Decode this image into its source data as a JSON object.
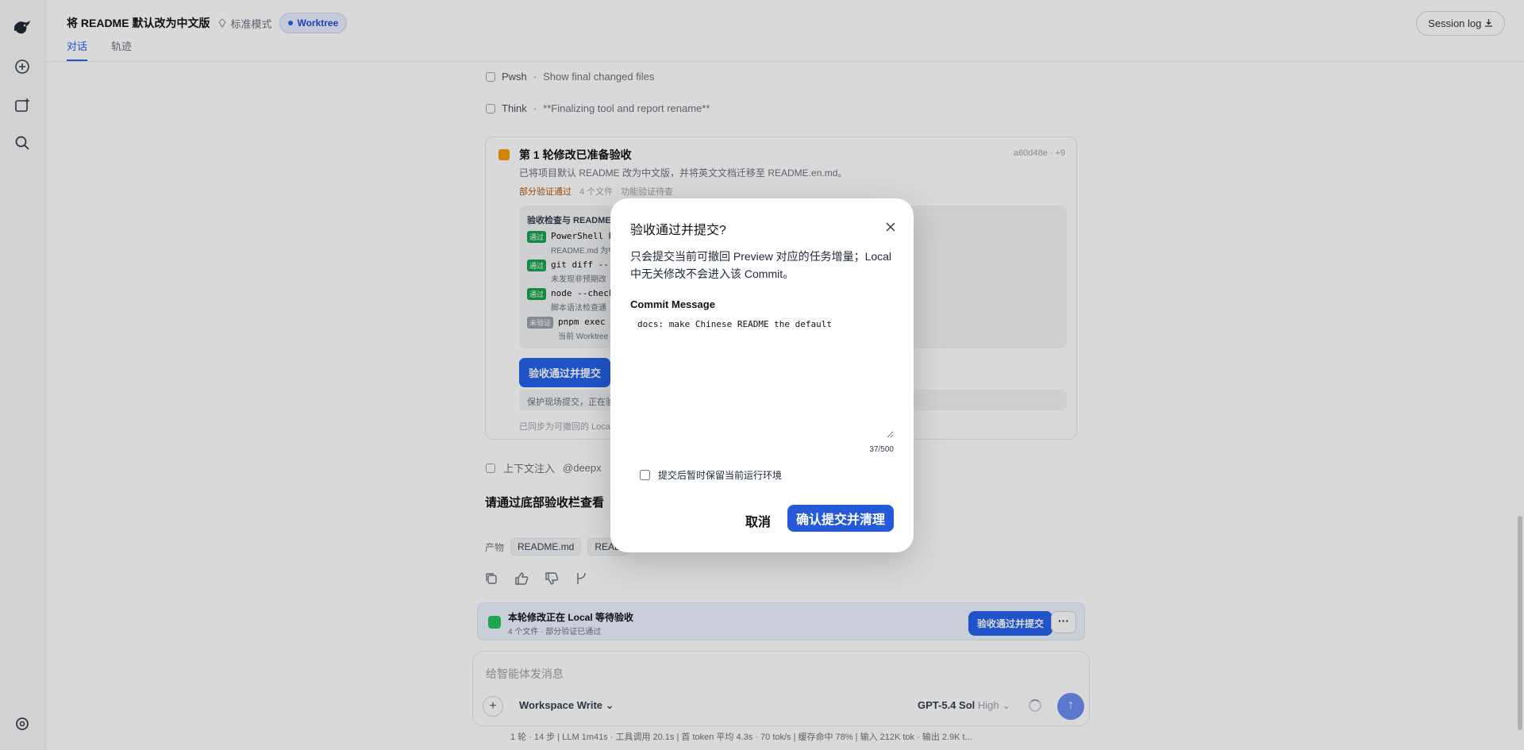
{
  "header": {
    "title": "将 README 默认改为中文版",
    "mode": "标准模式",
    "worktree": "Worktree",
    "tabs": [
      "对话",
      "轨迹"
    ],
    "session_log": "Session log"
  },
  "chat": {
    "steps": [
      {
        "kind": "Pwsh",
        "text": "Show final changed files"
      },
      {
        "kind": "Think",
        "text": "**Finalizing tool and report rename**"
      }
    ],
    "card": {
      "title": "第 1 轮修改已准备验收",
      "meta": "a60d48e · +9",
      "subtitle": "已将项目默认 README 改为中文版，并将英文文档迁移至 README.en.md。",
      "status": "部分验证通过",
      "files": "4 个文件",
      "verify": "功能验证待查",
      "inner_heading": "验收检查与 README 语言切换",
      "rows": [
        {
          "tag": "通过",
          "code": "PowerShell R",
          "note": "README.md 为中"
        },
        {
          "tag": "通过",
          "code": "git diff --",
          "note": "未发现非预期改"
        },
        {
          "tag": "通过",
          "code": "node --check",
          "note": "脚本语法检查通"
        },
        {
          "tag": "未验证",
          "code": "pnpm exec t",
          "note": "当前 Worktree"
        }
      ],
      "accept_button": "验收通过并提交",
      "gray_note": "保护现场提交，正在验收",
      "footer": "已同步为可撤回的 Local"
    },
    "context": "上下文注入",
    "context_mention": "@deepx",
    "prompt": "请通过底部验收栏查看",
    "artifacts_label": "产物",
    "artifacts": [
      "README.md",
      "READ"
    ]
  },
  "local_bar": {
    "title": "本轮修改正在 Local 等待验收",
    "subtitle": "4 个文件 · 部分验证已通过",
    "button": "验收通过并提交",
    "more": "···"
  },
  "composer": {
    "placeholder": "给智能体发消息",
    "workspace": "Workspace Write",
    "model": "GPT-5.4 Sol",
    "level": "High"
  },
  "stats": "1 轮 · 14 步  |  LLM 1m41s · 工具调用 20.1s  |  首 token 平均 4.3s · 70 tok/s  |  缓存命中 78%  |  输入 212K tok · 输出 2.9K t...",
  "modal": {
    "title": "验收通过并提交?",
    "description": "只会提交当前可撤回 Preview 对应的任务增量；Local 中无关修改不会进入该 Commit。",
    "commit_label": "Commit Message",
    "commit_value": "docs: make Chinese README the default",
    "counter": "37/500",
    "checkbox_label": "提交后暂时保留当前运行环境",
    "cancel": "取消",
    "confirm": "确认提交并清理"
  },
  "colors": {
    "accent": "#2559d8",
    "overlay": "rgba(0,0,0,0.15)"
  }
}
